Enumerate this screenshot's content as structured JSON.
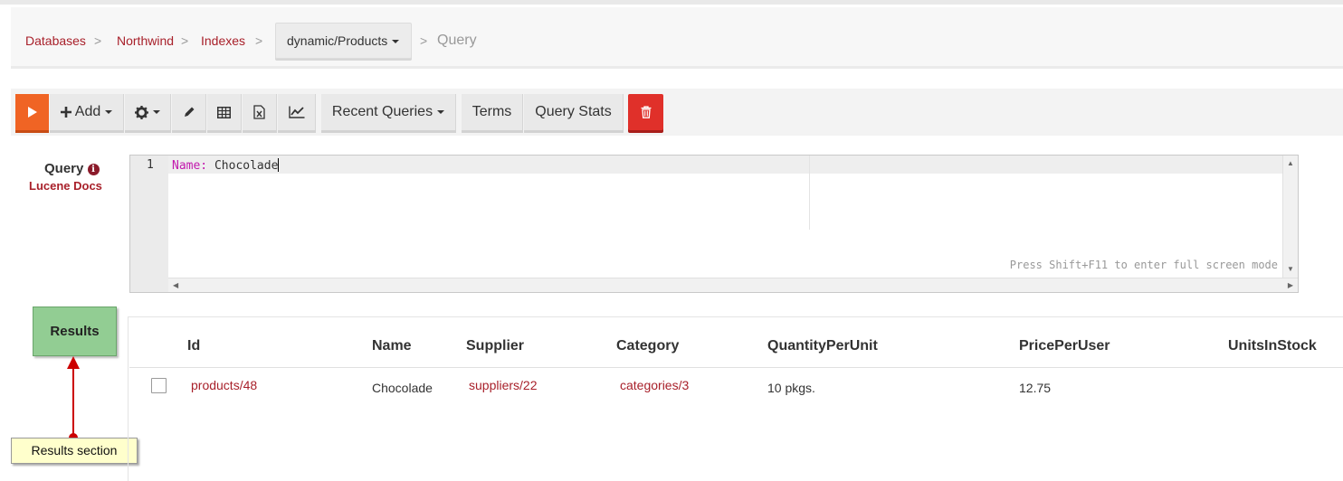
{
  "breadcrumb": {
    "items": [
      "Databases",
      "Northwind",
      "Indexes"
    ],
    "separator": ">",
    "dropdown": "dynamic/Products",
    "current": "Query"
  },
  "toolbar": {
    "add_label": "Add",
    "recent_queries_label": "Recent Queries",
    "terms_label": "Terms",
    "query_stats_label": "Query Stats"
  },
  "query": {
    "label": "Query",
    "docs_link": "Lucene Docs",
    "line_number": "1",
    "field": "Name:",
    "value": "Chocolade",
    "hint": "Press Shift+F11 to enter full screen mode"
  },
  "results": {
    "badge": "Results",
    "callout": "Results section",
    "columns": [
      "Id",
      "Name",
      "Supplier",
      "Category",
      "QuantityPerUnit",
      "PricePerUser",
      "UnitsInStock"
    ],
    "rows": [
      {
        "id": "products/48",
        "name": "Chocolade",
        "supplier": "suppliers/22",
        "category": "categories/3",
        "quantity_per_unit": "10 pkgs.",
        "price_per_user": "12.75"
      }
    ]
  },
  "colors": {
    "accent_link": "#a8202a",
    "run_button": "#f06424",
    "delete_button": "#e0302a",
    "results_badge": "#92cd93",
    "callout_bg": "#ffffcc"
  },
  "icons": [
    "play-icon",
    "plus-icon",
    "gear-icon",
    "pencil-icon",
    "table-icon",
    "excel-icon",
    "chart-icon",
    "trash-icon",
    "info-icon",
    "caret-down-icon"
  ]
}
